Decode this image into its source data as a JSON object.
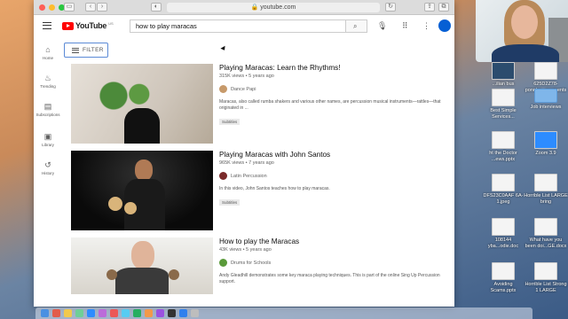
{
  "browser": {
    "url": "youtube.com"
  },
  "youtube": {
    "logo_text": "YouTube",
    "logo_country": "US",
    "search_query": "how to play maracas",
    "filter_label": "FILTER",
    "sidebar": [
      {
        "label": "Home",
        "icon": "home-icon"
      },
      {
        "label": "Trending",
        "icon": "fire-icon"
      },
      {
        "label": "Subscriptions",
        "icon": "subscriptions-icon"
      },
      {
        "label": "Library",
        "icon": "library-icon"
      },
      {
        "label": "History",
        "icon": "history-icon"
      }
    ],
    "results": [
      {
        "title": "Playing Maracas: Learn the Rhythms!",
        "meta": "315K views • 5 years ago",
        "channel": "Dance Papi",
        "description": "Maracas, also called rumba shakers and various other names, are percussion musical instruments—rattles—that originated in ...",
        "badge": "Subtitles"
      },
      {
        "title": "Playing Maracas with John Santos",
        "meta": "965K views • 7 years ago",
        "channel": "Latin Percussion",
        "description": "In this video, John Santos teaches how to play maracas.",
        "badge": "Subtitles"
      },
      {
        "title": "How to play the Maracas",
        "meta": "43K views • 5 years ago",
        "channel": "Drums for Schools",
        "description": "Andy Gleadhill demonstrates some key maraca playing techniques. This is part of the online Sing Up Percussion support.",
        "badge": ""
      }
    ]
  },
  "desktop": {
    "files": [
      {
        "label": "...ilian bus"
      },
      {
        "label": "625D2Z78-\nponcho...ocuments"
      },
      {
        "label": "Job interviews"
      },
      {
        "label": "Best Simple\nServices..."
      },
      {
        "label": "ht the Doctor\n...ews.pptx"
      },
      {
        "label": "Zoom 3.9"
      },
      {
        "label": "DFS23C0AAF\n6A-1.jpeg"
      },
      {
        "label": "Horrible List\nLARGE bring"
      },
      {
        "label": "108144\nyba...odie.doc"
      },
      {
        "label": "What have you\nbeen doi...GE.docx"
      },
      {
        "label": "Avoiding\nScams.pptx"
      },
      {
        "label": "Horrible List\nStrong 1 LARGE"
      }
    ]
  },
  "colors": {
    "youtube_red": "#ff0000",
    "filter_border": "#5b8ad6",
    "sign_in_blue": "#065fd4"
  }
}
